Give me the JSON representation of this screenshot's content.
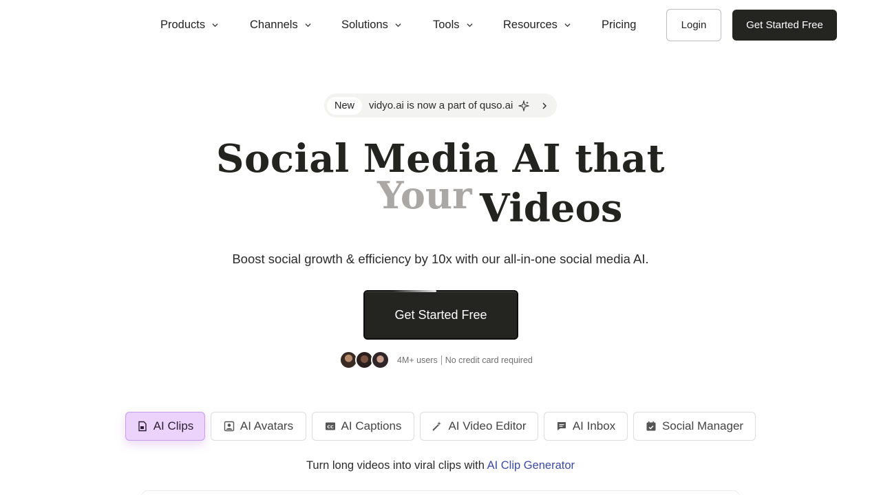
{
  "nav": {
    "items": [
      {
        "label": "Products",
        "has_dropdown": true
      },
      {
        "label": "Channels",
        "has_dropdown": true
      },
      {
        "label": "Solutions",
        "has_dropdown": true
      },
      {
        "label": "Tools",
        "has_dropdown": true
      },
      {
        "label": "Resources",
        "has_dropdown": true
      },
      {
        "label": "Pricing",
        "has_dropdown": false
      }
    ],
    "login_label": "Login",
    "cta_label": "Get Started Free"
  },
  "announcement": {
    "badge": "New",
    "text": "vidyo.ai is now a part of quso.ai",
    "icons": [
      "sparkle-icon",
      "chevron-right-icon"
    ]
  },
  "hero": {
    "headline_line1": "Social Media AI that",
    "headline_word_animated": "Your",
    "headline_word2": "Videos",
    "subheadline": "Boost social growth & efficiency by 10x with our all-in-one social media AI.",
    "cta_label": "Get Started Free",
    "users_text": "4M+ users",
    "no_card_text": "No credit card required"
  },
  "tabs": [
    {
      "label": "AI Clips",
      "icon": "file-video-icon",
      "active": true
    },
    {
      "label": "AI Avatars",
      "icon": "avatar-icon",
      "active": false
    },
    {
      "label": "AI Captions",
      "icon": "cc-icon",
      "active": false
    },
    {
      "label": "AI Video Editor",
      "icon": "magic-wand-icon",
      "active": false
    },
    {
      "label": "AI Inbox",
      "icon": "chat-icon",
      "active": false
    },
    {
      "label": "Social Manager",
      "icon": "calendar-icon",
      "active": false
    }
  ],
  "tagline": {
    "prefix": "Turn long videos into viral clips with",
    "link": "AI Clip Generator"
  },
  "colors": {
    "dark_button": "#242421",
    "active_tab_bg": "#ecd3fb",
    "link": "#3b4aa0",
    "muted_headline": "#a9a8a6"
  }
}
